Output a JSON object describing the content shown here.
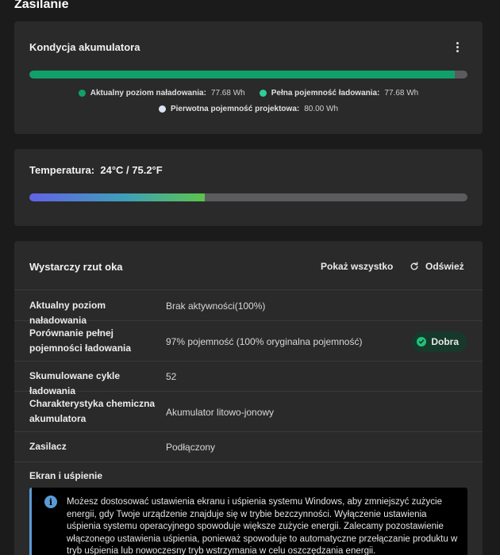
{
  "page": {
    "title": "Zasilanie"
  },
  "battery": {
    "title": "Kondycja akumulatora",
    "fill_fraction": 0.971,
    "legend": [
      {
        "key": "Aktualny poziom naładowania:",
        "value": "77.68 Wh",
        "color": "#10a06a"
      },
      {
        "key": "Pełna pojemność ładowania:",
        "value": "77.68 Wh",
        "color": "#2ccf95"
      },
      {
        "key": "Pierwotna pojemność projektowa:",
        "value": "80.00 Wh",
        "color": "#dde3f0"
      }
    ]
  },
  "temperature": {
    "label": "Temperatura:",
    "value": "24°C / 75.2°F",
    "fill_fraction": 0.4
  },
  "glance": {
    "title": "Wystarczy rzut oka",
    "show_all": "Pokaż wszystko",
    "refresh": "Odśwież",
    "rows": [
      {
        "label": "Aktualny poziom naładowania",
        "value": "Brak aktywności(100%)"
      },
      {
        "label": "Porównanie pełnej pojemności ładowania",
        "value": "97% pojemność (100% oryginalna pojemność)",
        "badge": "Dobra"
      },
      {
        "label": "Skumulowane cykle ładowania",
        "value": "52"
      },
      {
        "label": "Charakterystyka chemiczna akumulatora",
        "value": "Akumulator litowo-jonowy"
      },
      {
        "label": "Zasilacz",
        "value": "Podłączony"
      }
    ],
    "screen_section": "Ekran i uśpienie",
    "info_text": "Możesz dostosować ustawienia ekranu i uśpienia systemu Windows, aby zmniejszyć zużycie energii, gdy Twoje urządzenie znajduje się w trybie bezczynności. Wyłączenie ustawienia uśpienia systemu operacyjnego spowoduje większe zużycie energii. Zalecamy pozostawienie włączonego ustawienia uśpienia, ponieważ spowoduje to automatyczne przełączanie produktu w tryb uśpienia lub nowoczesny tryb wstrzymania w celu oszczędzania energii."
  },
  "colors": {
    "accent_green": "#10a06a",
    "info_blue": "#5b9bd5",
    "badge_bg": "#16392b"
  }
}
